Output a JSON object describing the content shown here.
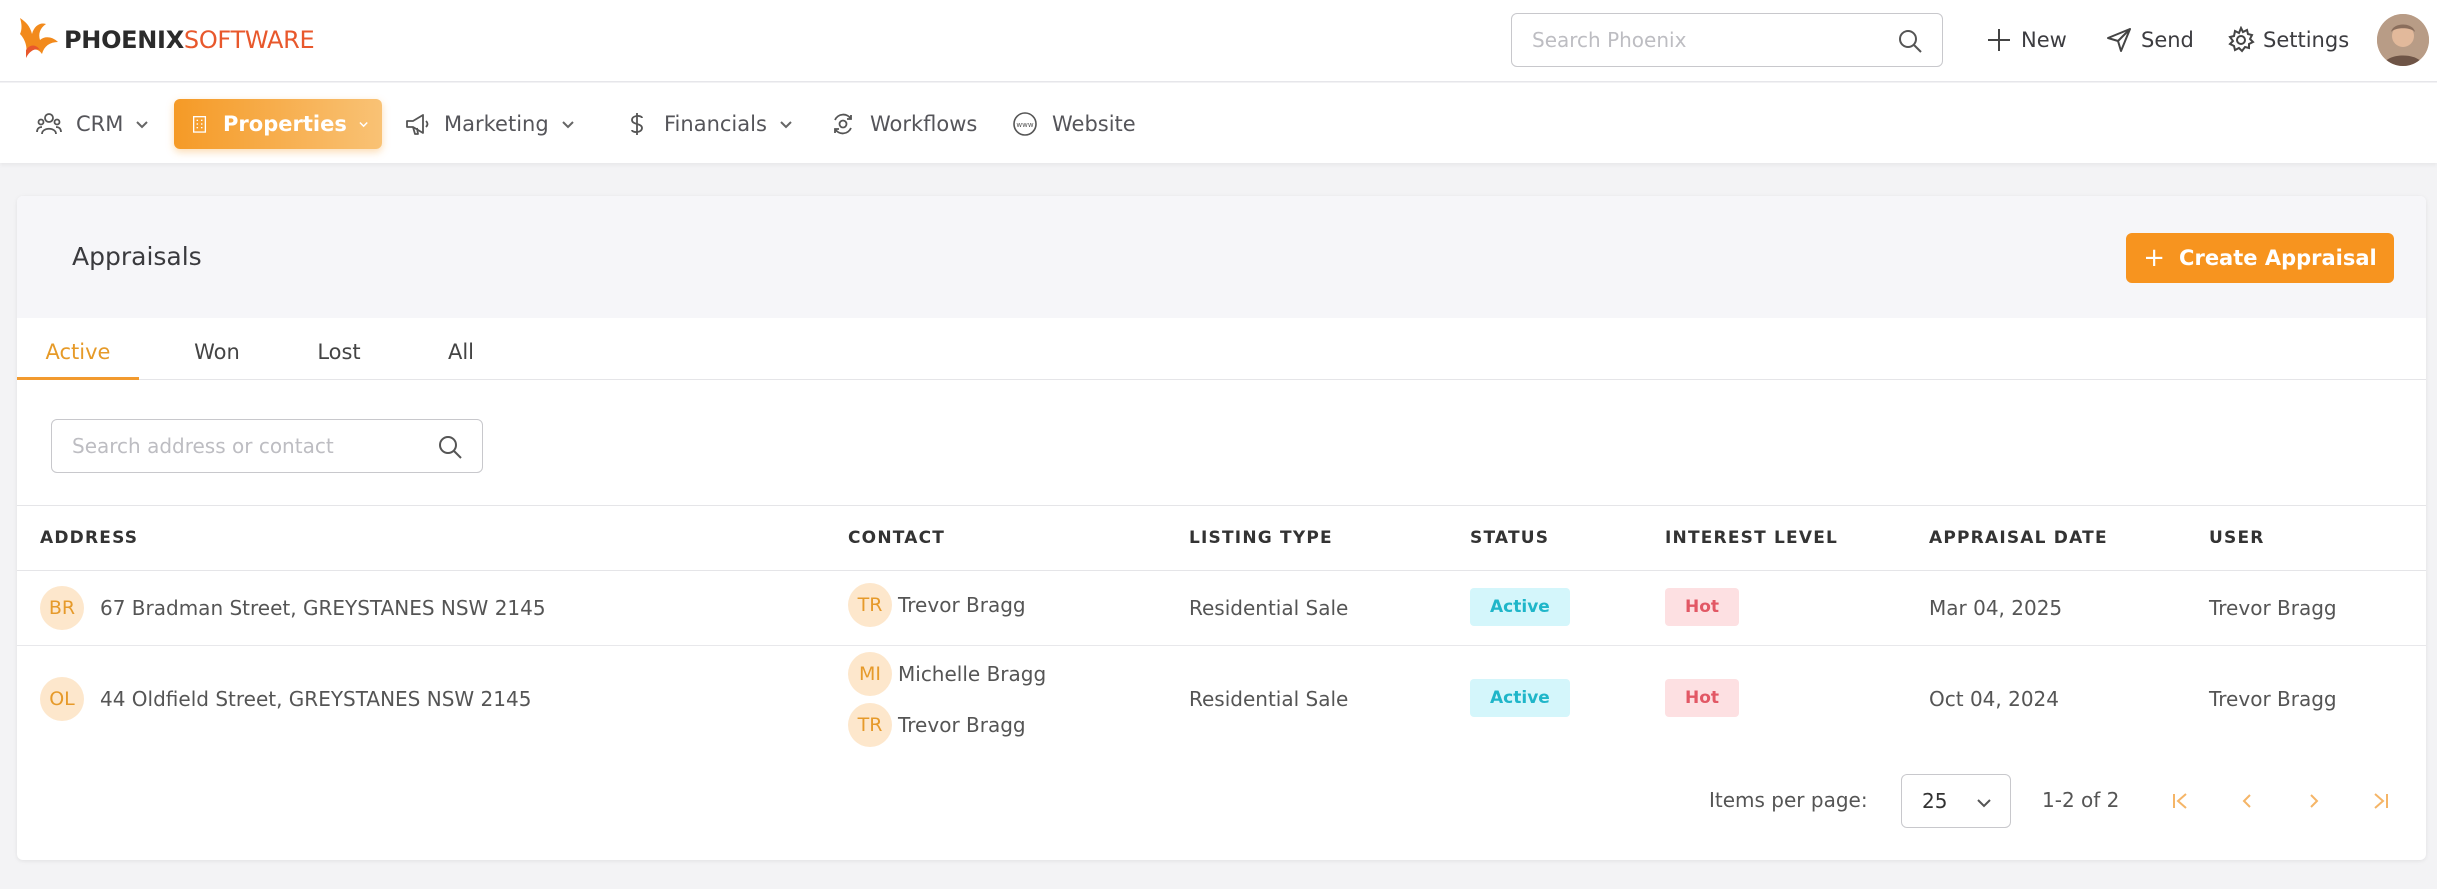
{
  "brand": {
    "name_bold": "PHOENIX",
    "name_light": "SOFTWARE",
    "accent_color": "#f7941f",
    "logo_icon": "phoenix-flame-icon"
  },
  "header": {
    "search_placeholder": "Search Phoenix",
    "new_label": "New",
    "send_label": "Send",
    "settings_label": "Settings"
  },
  "nav": {
    "items": [
      {
        "label": "CRM",
        "icon": "people-icon",
        "dropdown": true
      },
      {
        "label": "Properties",
        "icon": "building-icon",
        "dropdown": true,
        "active": true
      },
      {
        "label": "Marketing",
        "icon": "megaphone-icon",
        "dropdown": true
      },
      {
        "label": "Financials",
        "icon": "dollar-icon",
        "dropdown": true
      },
      {
        "label": "Workflows",
        "icon": "workflow-icon",
        "dropdown": false
      },
      {
        "label": "Website",
        "icon": "www-globe-icon",
        "dropdown": false
      }
    ]
  },
  "page": {
    "title": "Appraisals",
    "create_label": "Create Appraisal"
  },
  "tabs": [
    {
      "label": "Active",
      "active": true
    },
    {
      "label": "Won"
    },
    {
      "label": "Lost"
    },
    {
      "label": "All"
    }
  ],
  "table": {
    "search_placeholder": "Search address or contact",
    "columns": [
      "ADDRESS",
      "CONTACT",
      "LISTING TYPE",
      "STATUS",
      "INTEREST LEVEL",
      "APPRAISAL DATE",
      "USER"
    ],
    "rows": [
      {
        "address_initials": "BR",
        "address": "67 Bradman Street, GREYSTANES NSW 2145",
        "contacts": [
          {
            "initials": "TR",
            "name": "Trevor Bragg"
          }
        ],
        "listing_type": "Residential Sale",
        "status": "Active",
        "interest": "Hot",
        "date": "Mar 04, 2025",
        "user": "Trevor Bragg"
      },
      {
        "address_initials": "OL",
        "address": "44 Oldfield Street, GREYSTANES NSW 2145",
        "contacts": [
          {
            "initials": "MI",
            "name": "Michelle Bragg"
          },
          {
            "initials": "TR",
            "name": "Trevor Bragg"
          }
        ],
        "listing_type": "Residential Sale",
        "status": "Active",
        "interest": "Hot",
        "date": "Oct 04, 2024",
        "user": "Trevor Bragg"
      }
    ]
  },
  "pagination": {
    "items_per_page_label": "Items per page:",
    "page_size": "25",
    "range": "1-2 of 2"
  }
}
